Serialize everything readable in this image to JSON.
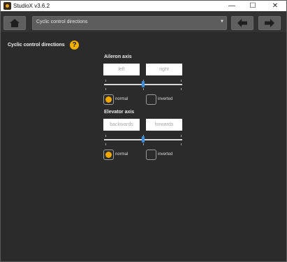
{
  "window": {
    "title": "StudioX v3.6.2",
    "minimize_glyph": "—",
    "maximize_glyph": "☐",
    "close_glyph": "✕"
  },
  "toolbar": {
    "nav_selected": "Cyclic control directions",
    "dropdown_caret": "▼",
    "home_icon": "home-icon",
    "back_icon": "arrow-left-icon",
    "forward_icon": "arrow-right-icon"
  },
  "page": {
    "title": "Cyclic control directions",
    "help_glyph": "?"
  },
  "aileron": {
    "label": "Aileron axis",
    "left_text": "left",
    "right_text": "right",
    "slider_value": 0.5,
    "normal_label": "normal",
    "inverted_label": "inverted",
    "selected": "normal"
  },
  "elevator": {
    "label": "Elevator axis",
    "left_text": "backwards",
    "right_text": "forwards",
    "slider_value": 0.5,
    "normal_label": "normal",
    "inverted_label": "inverted",
    "selected": "normal"
  },
  "colors": {
    "accent": "#f0a800",
    "slider_thumb": "#3b8de0",
    "background": "#2b2b2b"
  }
}
